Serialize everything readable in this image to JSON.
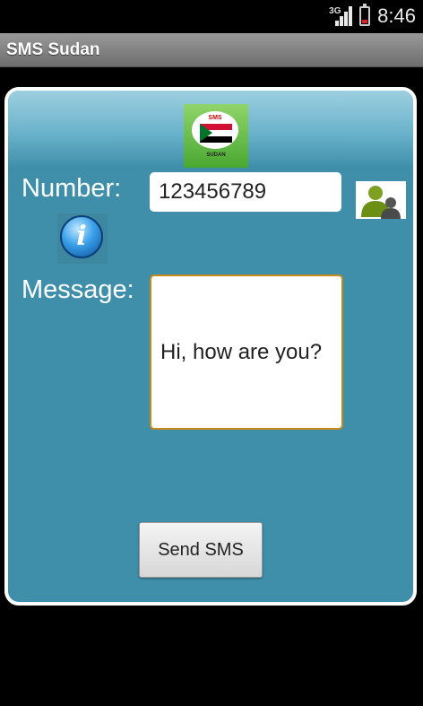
{
  "status_bar": {
    "network_type": "3G",
    "clock": "8:46",
    "battery_level": 0.2
  },
  "app": {
    "title": "SMS Sudan"
  },
  "logo": {
    "top_text": "SMS",
    "bottom_text": "SUDAN"
  },
  "form": {
    "number_label": "Number:",
    "number_value": "123456789",
    "message_label": "Message:",
    "message_value": "Hi, how are you?",
    "send_label": "Send SMS"
  },
  "icons": {
    "contacts": "contacts-icon",
    "info": "info-icon"
  },
  "colors": {
    "panel": "#3f8fab",
    "message_border": "#c88b1a",
    "flag_red": "#d21034",
    "flag_green": "#007229"
  }
}
